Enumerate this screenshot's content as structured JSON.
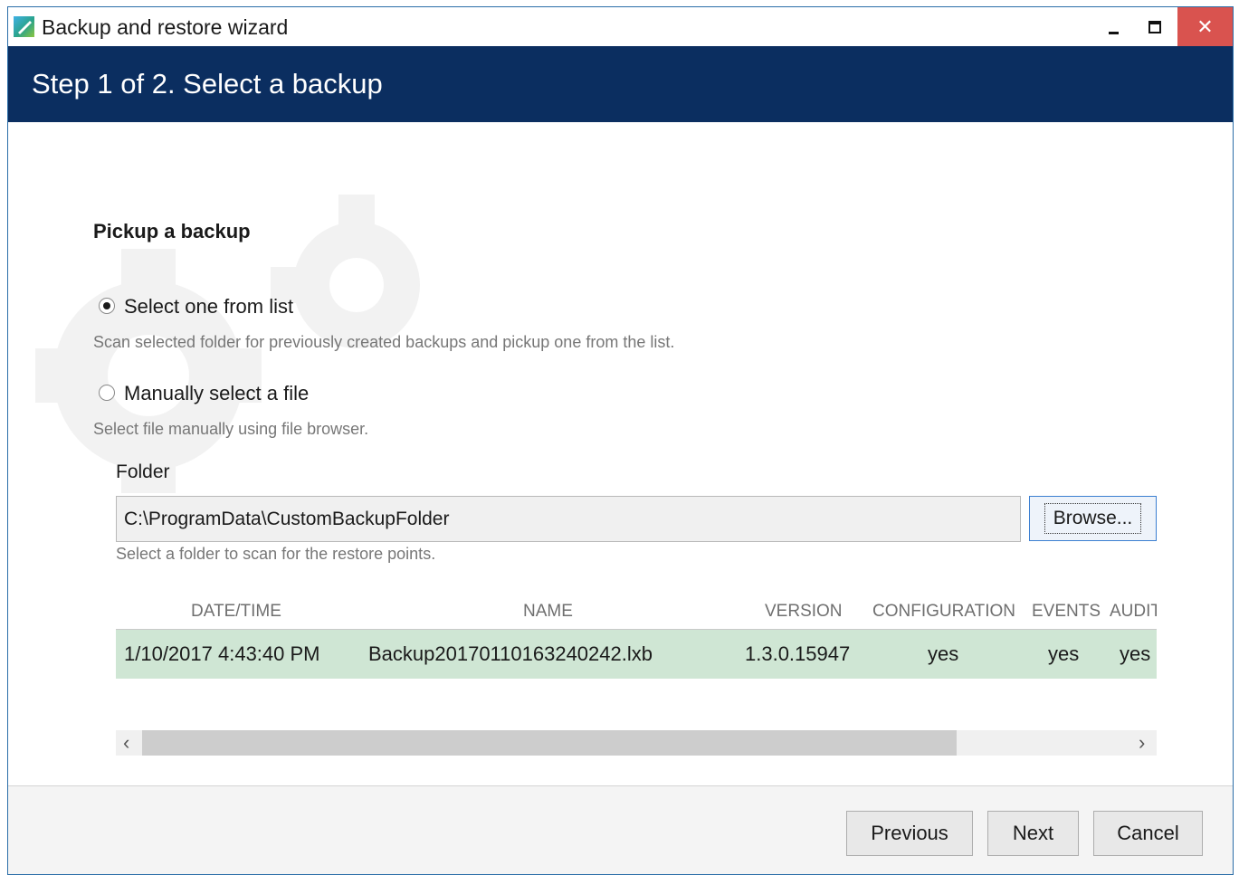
{
  "window": {
    "title": "Backup and restore wizard",
    "close_glyph": "✕"
  },
  "header": {
    "step_title": "Step 1 of 2. Select a backup"
  },
  "content": {
    "section_title": "Pickup a backup",
    "options": [
      {
        "label": "Select one from list",
        "hint": "Scan selected folder for previously created backups and pickup one from the list.",
        "selected": true
      },
      {
        "label": "Manually select a file",
        "hint": "Select file manually using file browser.",
        "selected": false
      }
    ],
    "folder": {
      "label": "Folder",
      "value": "C:\\ProgramData\\CustomBackupFolder",
      "browse_label": "Browse...",
      "hint": "Select a folder to scan for the restore points."
    },
    "grid": {
      "columns": [
        "DATE/TIME",
        "NAME",
        "VERSION",
        "CONFIGURATION",
        "EVENTS",
        "AUDIT"
      ],
      "rows": [
        [
          "1/10/2017 4:43:40 PM",
          "Backup20170110163240242.lxb",
          "1.3.0.15947",
          "yes",
          "yes",
          "yes"
        ]
      ],
      "scroll_left": "‹",
      "scroll_right": "›"
    }
  },
  "footer": {
    "previous_label": "Previous",
    "next_label": "Next",
    "cancel_label": "Cancel"
  },
  "colors": {
    "header_bg": "#0b2e60",
    "selected_row": "#cfe6d4",
    "close_btn": "#d9534f"
  },
  "icons": [
    "app-icon",
    "minimize-icon",
    "maximize-icon",
    "close-icon",
    "gear-decor-icon",
    "scroll-left-icon",
    "scroll-right-icon"
  ]
}
